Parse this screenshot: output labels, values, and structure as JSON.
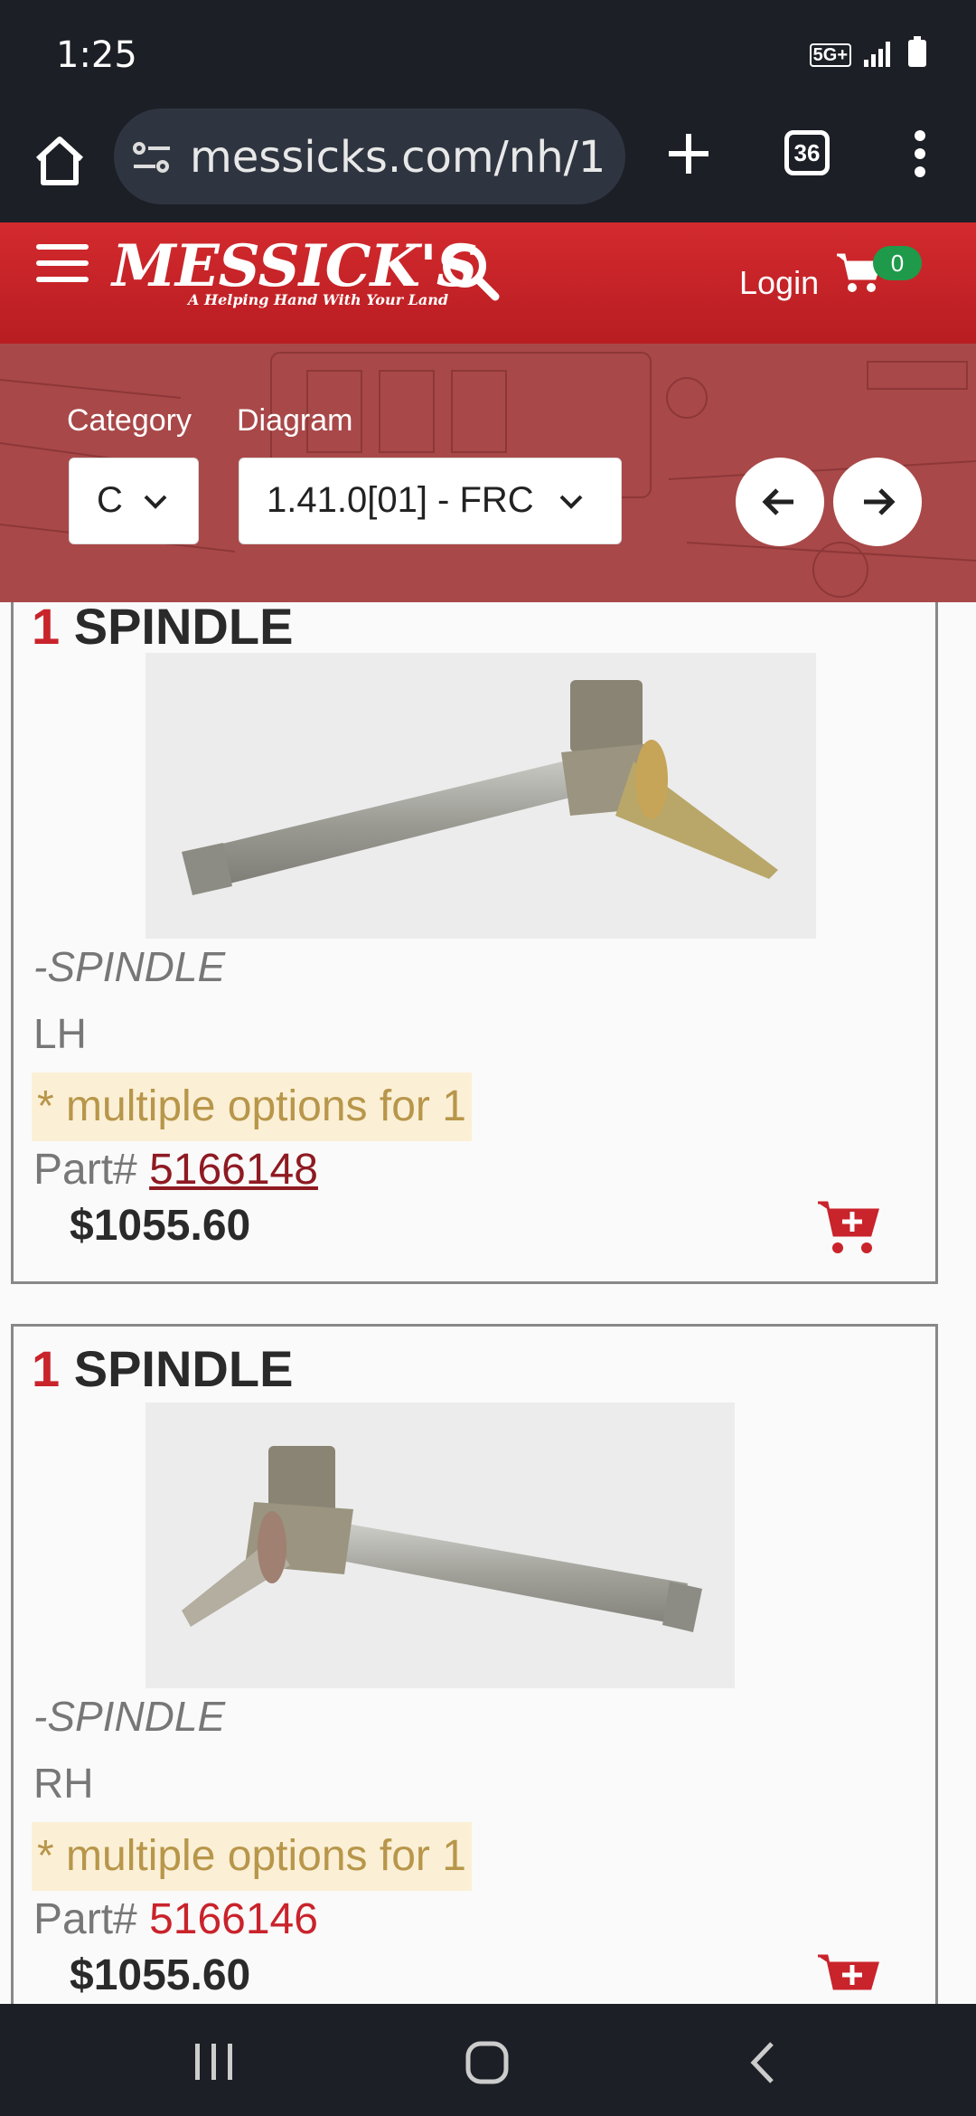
{
  "status": {
    "time": "1:25",
    "network": "5G+"
  },
  "browser": {
    "url": "messicks.com/nh/1",
    "tab_count": "36"
  },
  "site": {
    "logo": "MESSICK'S",
    "tagline": "A Helping Hand With Your Land",
    "login_label": "Login",
    "cart_count": "0"
  },
  "filters": {
    "category_label": "Category",
    "category_value": "C",
    "diagram_label": "Diagram",
    "diagram_value": "1.41.0[01] - FRC"
  },
  "parts": [
    {
      "qty": "1",
      "name": "SPINDLE",
      "description": "-SPINDLE",
      "side": "LH",
      "options": "* multiple options for 1",
      "part_label": "Part#",
      "part_number": "5166148",
      "price": "$1055.60"
    },
    {
      "qty": "1",
      "name": "SPINDLE",
      "description": "-SPINDLE",
      "side": "RH",
      "options": "* multiple options for 1",
      "part_label": "Part#",
      "part_number": "5166146",
      "price": "$1055.60"
    }
  ],
  "colors": {
    "brand_red": "#c9232b",
    "header_red": "#d32a2e",
    "badge_green": "#1f9a4a",
    "option_bg": "#fbf0d6"
  }
}
